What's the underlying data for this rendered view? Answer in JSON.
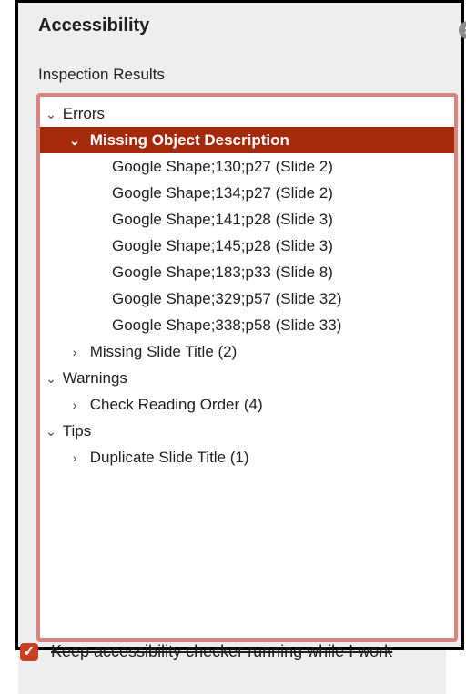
{
  "pane": {
    "title": "Accessibility",
    "close_glyph": "×"
  },
  "results": {
    "label": "Inspection Results",
    "errors": {
      "label": "Errors",
      "missing_object_description": {
        "label": "Missing Object Description",
        "items": [
          "Google Shape;130;p27  (Slide 2)",
          "Google Shape;134;p27  (Slide 2)",
          "Google Shape;141;p28  (Slide 3)",
          "Google Shape;145;p28  (Slide 3)",
          "Google Shape;183;p33  (Slide 8)",
          "Google Shape;329;p57  (Slide 32)",
          "Google Shape;338;p58  (Slide 33)"
        ]
      },
      "missing_slide_title": "Missing Slide Title (2)"
    },
    "warnings": {
      "label": "Warnings",
      "check_reading_order": "Check Reading Order (4)"
    },
    "tips": {
      "label": "Tips",
      "duplicate_slide_title": "Duplicate Slide Title (1)"
    }
  },
  "footer": {
    "keep_running_label": "Keep accessibility checker running while I work",
    "keep_running_checked": true
  },
  "icons": {
    "expanded": "chevron-down-icon",
    "collapsed": "chevron-right-icon",
    "check": "checkmark-icon",
    "close": "close-icon"
  },
  "colors": {
    "selection": "#a52a0c",
    "box_border": "#d9847d",
    "checkbox": "#c8401e"
  }
}
